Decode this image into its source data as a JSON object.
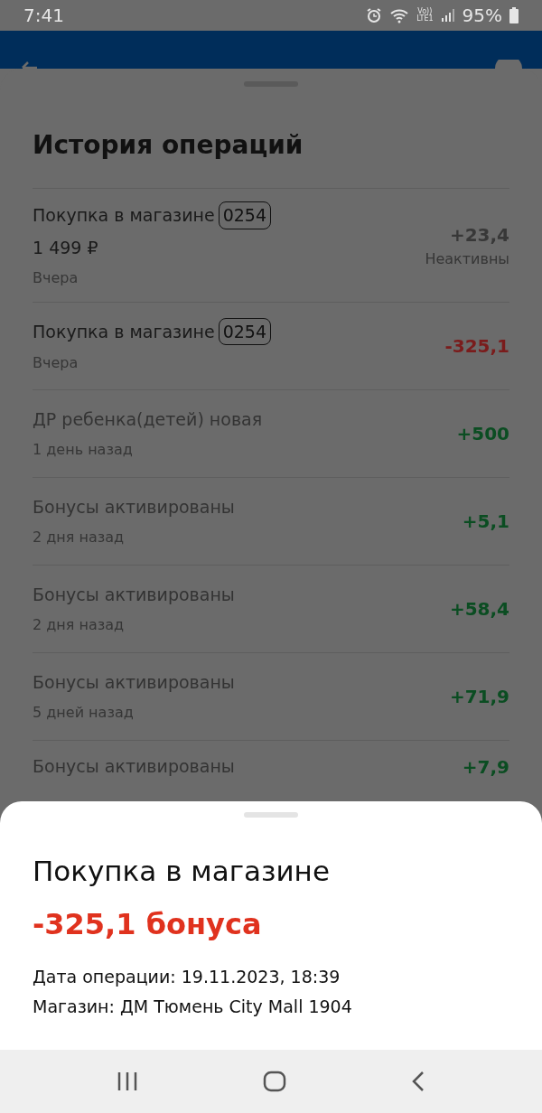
{
  "status_bar": {
    "time": "7:41",
    "network": "Vo))\nLTE1",
    "battery": "95%"
  },
  "history": {
    "title": "История операций",
    "operations": [
      {
        "title": "Покупка в магазине",
        "code": "0254",
        "price": "1 499 ₽",
        "date": "Вчера",
        "amount": "+23,4",
        "note": "Неактивны",
        "kind": "inactive"
      },
      {
        "title": "Покупка в магазине",
        "code": "0254",
        "date": "Вчера",
        "amount": "-325,1",
        "kind": "debit"
      },
      {
        "title": "ДР ребенка(детей) новая",
        "date": "1 день назад",
        "amount": "+500",
        "kind": "credit"
      },
      {
        "title": "Бонусы активированы",
        "date": "2 дня назад",
        "amount": "+5,1",
        "kind": "credit"
      },
      {
        "title": "Бонусы активированы",
        "date": "2 дня назад",
        "amount": "+58,4",
        "kind": "credit"
      },
      {
        "title": "Бонусы активированы",
        "date": "5 дней назад",
        "amount": "+71,9",
        "kind": "credit"
      },
      {
        "title": "Бонусы активированы",
        "amount": "+7,9",
        "kind": "credit"
      }
    ]
  },
  "details": {
    "title": "Покупка в магазине",
    "amount": "-325,1 бонуса",
    "lines": [
      "Дата операции: 19.11.2023, 18:39",
      "Магазин: ДМ Тюмень City Mall 1904"
    ]
  }
}
